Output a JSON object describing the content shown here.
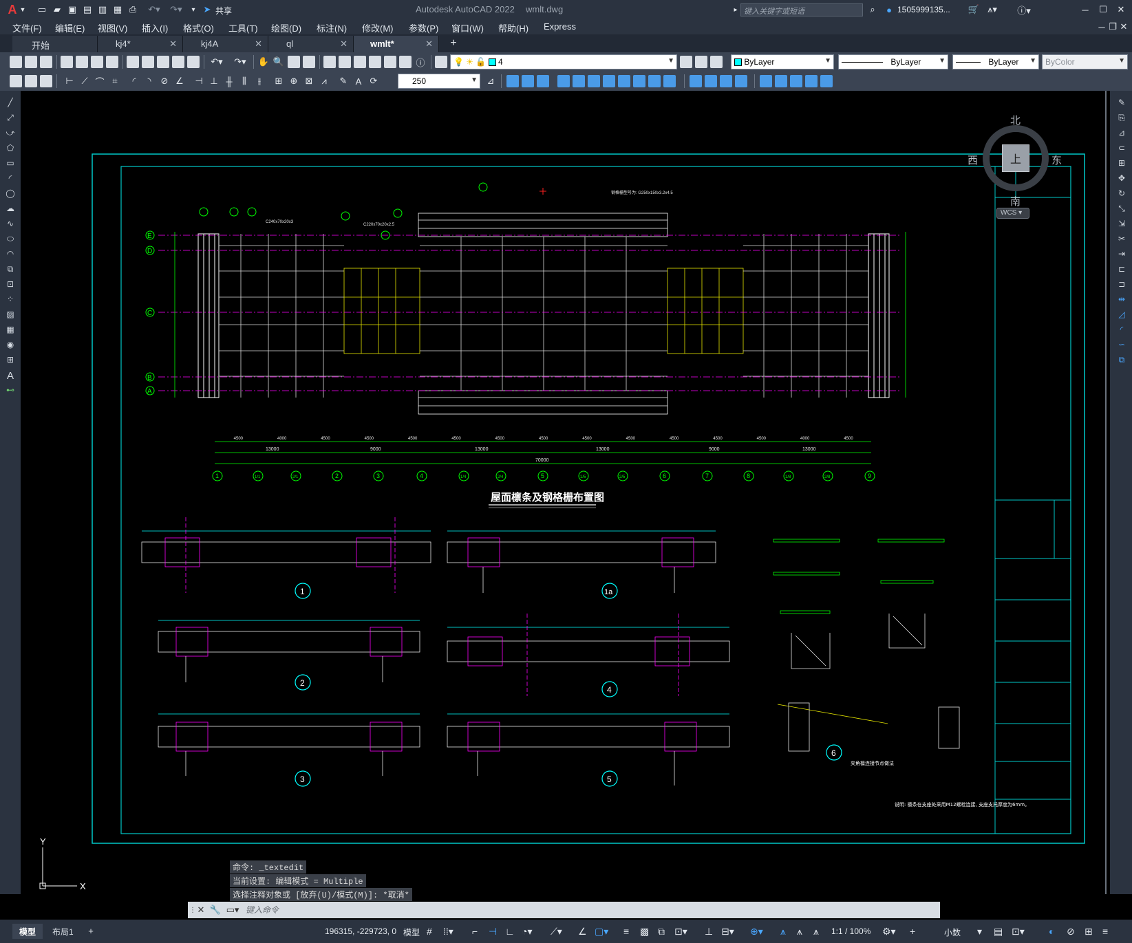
{
  "titlebar": {
    "app_name": "Autodesk AutoCAD 2022",
    "file_name": "wmlt.dwg",
    "search_placeholder": "键入关键字或短语",
    "user": "1505999135...",
    "share_label": "共享"
  },
  "menu": [
    "文件(F)",
    "编辑(E)",
    "视图(V)",
    "插入(I)",
    "格式(O)",
    "工具(T)",
    "绘图(D)",
    "标注(N)",
    "修改(M)",
    "参数(P)",
    "窗口(W)",
    "帮助(H)",
    "Express"
  ],
  "tabs": [
    {
      "label": "开始",
      "active": false,
      "closable": false
    },
    {
      "label": "kj4*",
      "active": false,
      "closable": true
    },
    {
      "label": "kj4A",
      "active": false,
      "closable": true
    },
    {
      "label": "ql",
      "active": false,
      "closable": true
    },
    {
      "label": "wmlt*",
      "active": true,
      "closable": true
    }
  ],
  "properties": {
    "layer": "4",
    "color": "ByLayer",
    "linetype": "ByLayer",
    "lineweight": "ByLayer",
    "plotstyle": "ByColor",
    "dim_scale": "250"
  },
  "viewcube": {
    "north": "北",
    "south": "南",
    "east": "东",
    "west": "西",
    "face": "上",
    "wcs": "WCS"
  },
  "drawing": {
    "title": "屋面檩条及钢格栅布置图",
    "axis_letters": [
      "E",
      "D",
      "C",
      "B",
      "A"
    ],
    "axis_numbers": [
      "1",
      "1/1",
      "2/1",
      "2",
      "3",
      "4",
      "1/4",
      "2/4",
      "5",
      "1/5",
      "2/5",
      "6",
      "7",
      "8",
      "1/8",
      "2/8",
      "9"
    ],
    "dims_row1": [
      "4500",
      "4000",
      "4500",
      "4500",
      "4500",
      "4500",
      "4500",
      "4500",
      "4500",
      "4500",
      "4500",
      "4500",
      "4500",
      "4000",
      "4500"
    ],
    "dims_row2": [
      "13000",
      "9000",
      "13000",
      "13000",
      "9000",
      "13000"
    ],
    "total_dim": "70000",
    "section_labels": [
      "1",
      "1a",
      "2",
      "4",
      "3",
      "5",
      "6"
    ],
    "note": "说明: 檩条在支座处采用M12螺栓连接, 支座支托厚度为6mm。",
    "detail_note": "夹角檩连接节点做法",
    "purlin_label": "C220x70x20x2.5",
    "purlin_label2": "C240x70x20x3",
    "grid_note": "钢格栅型号为: G250x150x3.2x4.5"
  },
  "command": {
    "history": [
      "命令: _textedit",
      "当前设置: 编辑模式 = Multiple",
      "选择注释对象或 [放弃(U)/模式(M)]: *取消*"
    ],
    "placeholder": "键入命令"
  },
  "status": {
    "coords": "196315, -229723, 0",
    "space": "模型",
    "scale": "1:1 / 100%",
    "units": "小数",
    "layout_tabs": [
      "模型",
      "布局1"
    ]
  }
}
